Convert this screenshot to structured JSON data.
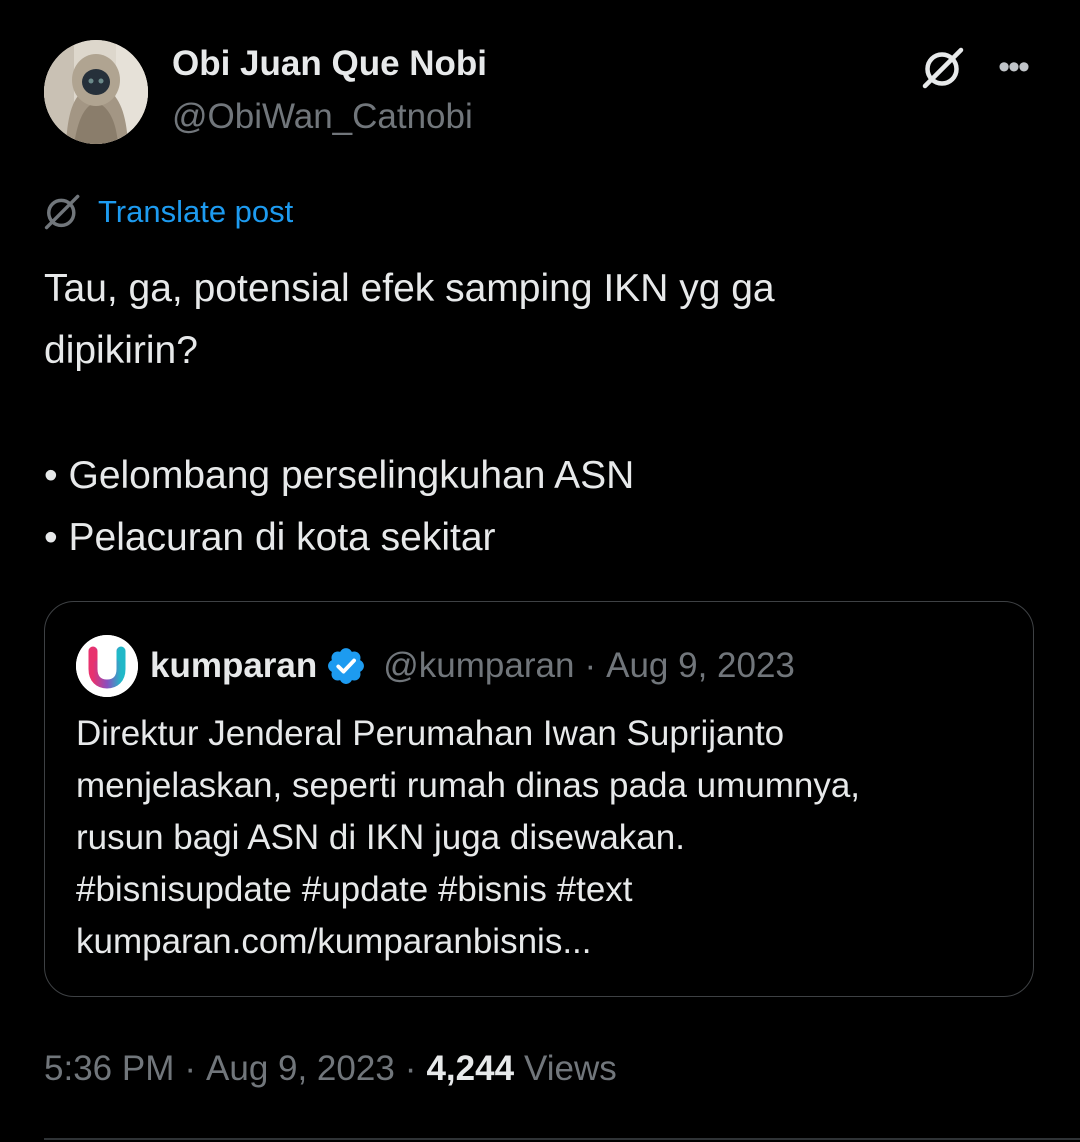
{
  "author": {
    "name": "Obi Juan Que Nobi",
    "handle": "@ObiWan_Catnobi"
  },
  "header_icons": {
    "grok": "grok-icon",
    "more": "more-icon",
    "more_glyph": "•••"
  },
  "translate": {
    "label": "Translate post",
    "icon": "grok-icon"
  },
  "tweet": {
    "lines": [
      "Tau, ga, potensial efek samping IKN yg ga",
      "dipikirin?",
      "",
      "• Gelombang perselingkuhan ASN",
      "• Pelacuran di kota sekitar"
    ]
  },
  "quote": {
    "name": "kumparan",
    "verified_icon": "verified-badge-icon",
    "handle": "@kumparan",
    "separator": "·",
    "date": "Aug 9, 2023",
    "lines": [
      "Direktur Jenderal Perumahan Iwan Suprijanto",
      "menjelaskan, seperti rumah dinas pada umumnya,",
      "rusun bagi ASN di IKN juga disewakan.",
      "#bisnisupdate #update #bisnis #text",
      "kumparan.com/kumparanbisnis..."
    ]
  },
  "meta": {
    "time": "5:36 PM",
    "separator": "·",
    "date": "Aug 9, 2023",
    "views_count": "4,244",
    "views_label": "Views"
  },
  "colors": {
    "background": "#000000",
    "text_primary": "#e7e9ea",
    "text_secondary": "#71767b",
    "link": "#1d9bf0",
    "border": "#3e4144",
    "verified": "#1d9bf0"
  }
}
